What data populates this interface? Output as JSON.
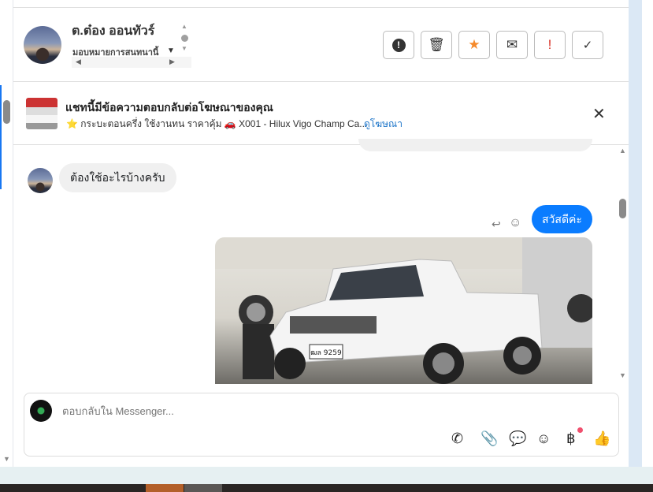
{
  "header": {
    "contact_name": "ต.ต๋อง ออนทัวร์",
    "assign_label": "มอบหมายการสนทนานี้",
    "actions": [
      {
        "name": "spam",
        "icon": "exclamation-octagon-icon"
      },
      {
        "name": "delete",
        "icon": "trash-icon"
      },
      {
        "name": "star",
        "icon": "star-icon",
        "color": "#f5892a"
      },
      {
        "name": "mark-unread",
        "icon": "envelope-icon"
      },
      {
        "name": "important",
        "icon": "exclamation-icon",
        "color": "#d93025"
      },
      {
        "name": "done",
        "icon": "check-icon"
      }
    ]
  },
  "ad_banner": {
    "title": "แชทนี้มีข้อความตอบกลับต่อโฆษณาของคุณ",
    "subtitle": "⭐ กระบะตอนครึ่ง ใช้งานทน ราคาคุ้ม 🚗 X001 - Hilux Vigo Champ Ca...",
    "link": "ดูโฆษณา"
  },
  "messages": [
    {
      "direction": "incoming",
      "text": "ต้องใช้อะไรบ้างครับ"
    },
    {
      "direction": "outgoing",
      "text": "สวัสดีค่ะ"
    },
    {
      "direction": "outgoing",
      "type": "image",
      "plate": "ฒล 9259"
    }
  ],
  "composer": {
    "placeholder": "ตอบกลับใน Messenger...",
    "tools": [
      "call-plus-icon",
      "paperclip-icon",
      "chat-bubble-icon",
      "emoji-icon",
      "baht-icon",
      "thumbs-up-icon"
    ]
  },
  "colors": {
    "outgoing_bubble": "#0a7cff",
    "link": "#1a73c8"
  }
}
